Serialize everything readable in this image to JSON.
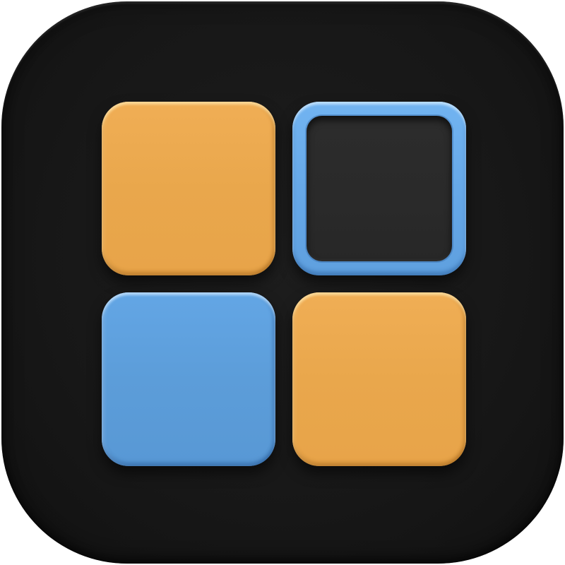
{
  "icon": {
    "name": "grid-app-icon",
    "background_color": "#181818",
    "tiles": [
      {
        "id": "top-left",
        "style": "filled",
        "color": "#e9a74c"
      },
      {
        "id": "top-right",
        "style": "outline",
        "color": "#66a8e8",
        "inner_color": "#2a2a2a"
      },
      {
        "id": "bottom-left",
        "style": "filled",
        "color": "#5c9dd9"
      },
      {
        "id": "bottom-right",
        "style": "filled",
        "color": "#e9a74c"
      }
    ]
  }
}
